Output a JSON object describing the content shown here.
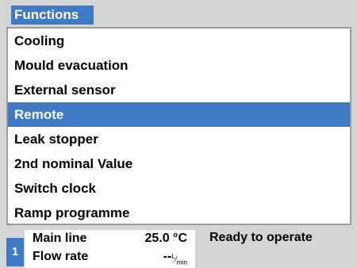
{
  "title": "Functions",
  "menu": {
    "items": [
      {
        "label": "Cooling",
        "selected": false
      },
      {
        "label": "Mould evacuation",
        "selected": false
      },
      {
        "label": "External sensor",
        "selected": false
      },
      {
        "label": "Remote",
        "selected": true
      },
      {
        "label": "Leak stopper",
        "selected": false
      },
      {
        "label": "2nd nominal Value",
        "selected": false
      },
      {
        "label": "Switch clock",
        "selected": false
      },
      {
        "label": "Ramp programme",
        "selected": false
      }
    ]
  },
  "status": {
    "pump_number": "1",
    "main_line_label": "Main line",
    "main_line_value": "25.0 °C",
    "flow_rate_label": "Flow rate",
    "flow_rate_value": "--",
    "flow_rate_unit_num": "L",
    "flow_rate_unit_den": "min",
    "state_text": "Ready to operate"
  },
  "colors": {
    "accent": "#3f7ac4",
    "background": "#d4d4d4",
    "panel": "#ffffff"
  }
}
